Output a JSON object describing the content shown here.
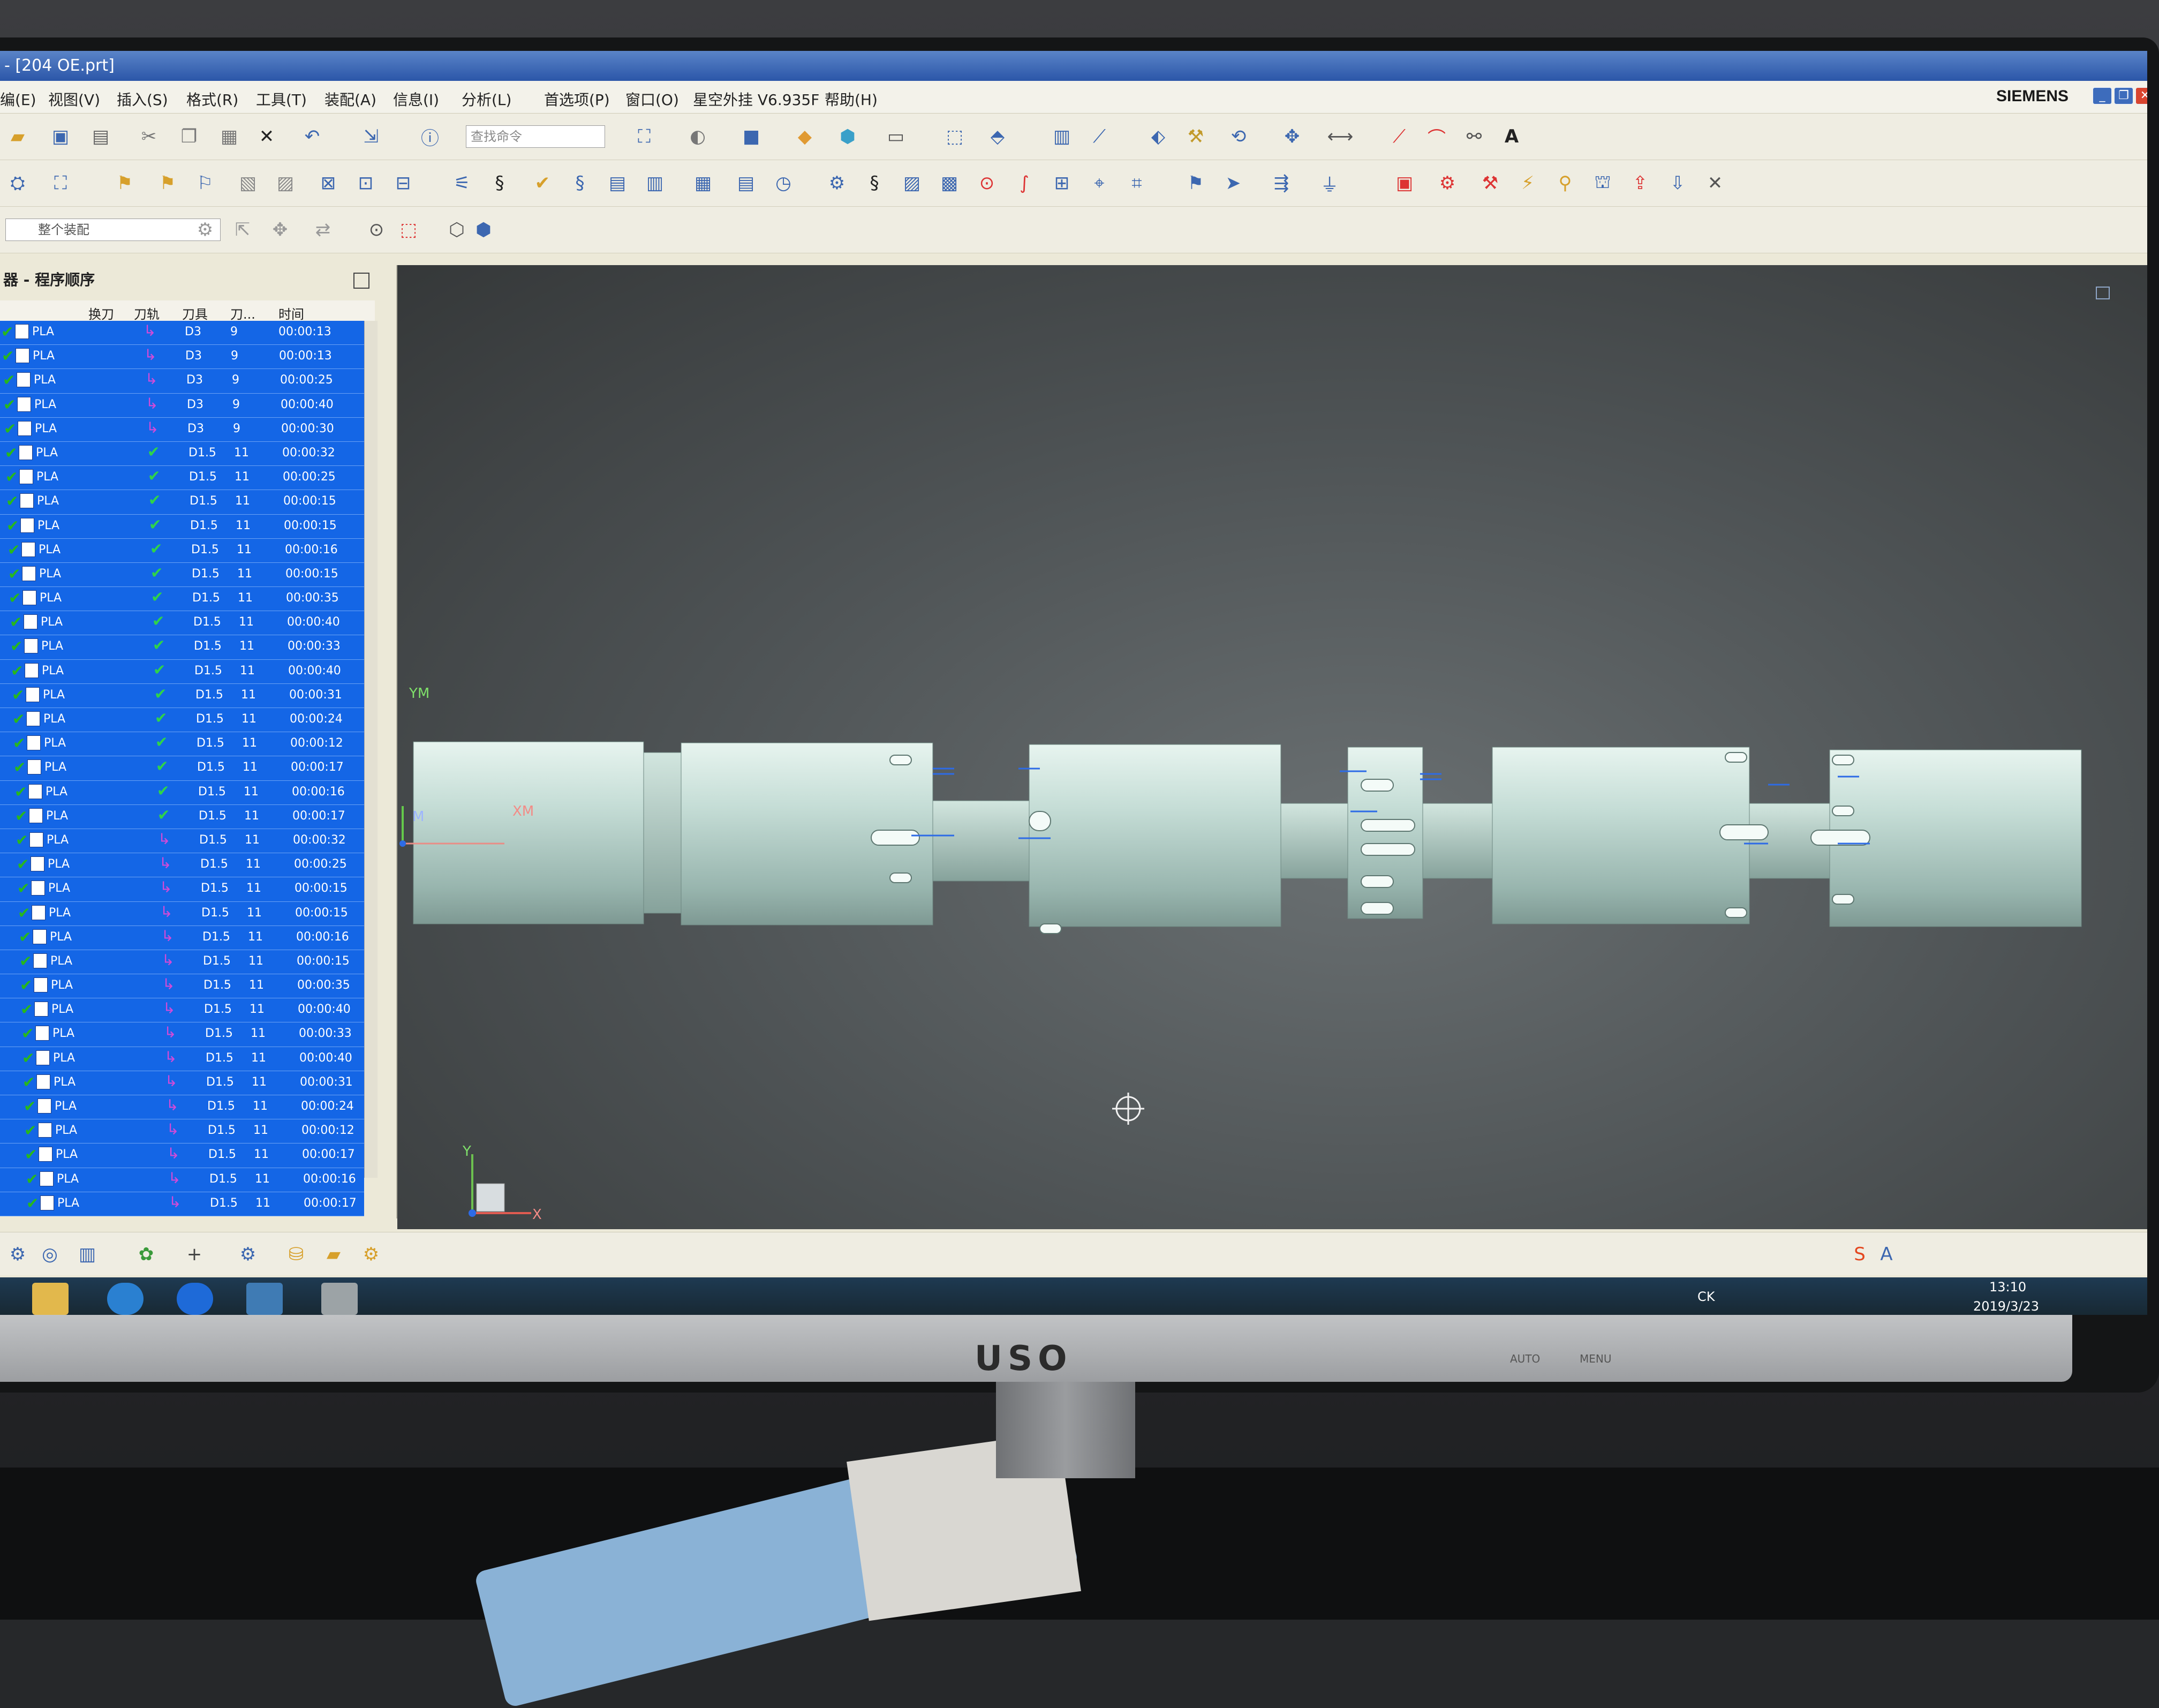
{
  "window": {
    "title": "- [204 OE.prt]",
    "brand": "SIEMENS"
  },
  "menu": [
    "编(E)",
    "视图(V)",
    "插入(S)",
    "格式(R)",
    "工具(T)",
    "装配(A)",
    "信息(I)",
    "分析(L)",
    "首选项(P)",
    "窗口(O)",
    "星空外挂 V6.935F",
    "帮助(H)"
  ],
  "toolbar": {
    "search_placeholder": "查找命令",
    "assembly_filter": "整个装配"
  },
  "navigator": {
    "title": "器 - 程序顺序",
    "columns": [
      "换刀",
      "刀轨",
      "刀具",
      "刀...",
      "时间"
    ],
    "rows": [
      {
        "name": "PLA",
        "path": "arrow",
        "tool": "D3",
        "num": "9",
        "time": "00:00:13"
      },
      {
        "name": "PLA",
        "path": "arrow",
        "tool": "D3",
        "num": "9",
        "time": "00:00:13"
      },
      {
        "name": "PLA",
        "path": "arrow",
        "tool": "D3",
        "num": "9",
        "time": "00:00:25"
      },
      {
        "name": "PLA",
        "path": "arrow",
        "tool": "D3",
        "num": "9",
        "time": "00:00:40"
      },
      {
        "name": "PLA",
        "path": "arrow",
        "tool": "D3",
        "num": "9",
        "time": "00:00:30"
      },
      {
        "name": "PLA",
        "path": "ok",
        "tool": "D1.5",
        "num": "11",
        "time": "00:00:32"
      },
      {
        "name": "PLA",
        "path": "ok",
        "tool": "D1.5",
        "num": "11",
        "time": "00:00:25"
      },
      {
        "name": "PLA",
        "path": "ok",
        "tool": "D1.5",
        "num": "11",
        "time": "00:00:15"
      },
      {
        "name": "PLA",
        "path": "ok",
        "tool": "D1.5",
        "num": "11",
        "time": "00:00:15"
      },
      {
        "name": "PLA",
        "path": "ok",
        "tool": "D1.5",
        "num": "11",
        "time": "00:00:16"
      },
      {
        "name": "PLA",
        "path": "ok",
        "tool": "D1.5",
        "num": "11",
        "time": "00:00:15"
      },
      {
        "name": "PLA",
        "path": "ok",
        "tool": "D1.5",
        "num": "11",
        "time": "00:00:35"
      },
      {
        "name": "PLA",
        "path": "ok",
        "tool": "D1.5",
        "num": "11",
        "time": "00:00:40"
      },
      {
        "name": "PLA",
        "path": "ok",
        "tool": "D1.5",
        "num": "11",
        "time": "00:00:33"
      },
      {
        "name": "PLA",
        "path": "ok",
        "tool": "D1.5",
        "num": "11",
        "time": "00:00:40"
      },
      {
        "name": "PLA",
        "path": "ok",
        "tool": "D1.5",
        "num": "11",
        "time": "00:00:31"
      },
      {
        "name": "PLA",
        "path": "ok",
        "tool": "D1.5",
        "num": "11",
        "time": "00:00:24"
      },
      {
        "name": "PLA",
        "path": "ok",
        "tool": "D1.5",
        "num": "11",
        "time": "00:00:12"
      },
      {
        "name": "PLA",
        "path": "ok",
        "tool": "D1.5",
        "num": "11",
        "time": "00:00:17"
      },
      {
        "name": "PLA",
        "path": "ok",
        "tool": "D1.5",
        "num": "11",
        "time": "00:00:16"
      },
      {
        "name": "PLA",
        "path": "ok",
        "tool": "D1.5",
        "num": "11",
        "time": "00:00:17"
      },
      {
        "name": "PLA",
        "path": "arrow",
        "tool": "D1.5",
        "num": "11",
        "time": "00:00:32"
      },
      {
        "name": "PLA",
        "path": "arrow",
        "tool": "D1.5",
        "num": "11",
        "time": "00:00:25"
      },
      {
        "name": "PLA",
        "path": "arrow",
        "tool": "D1.5",
        "num": "11",
        "time": "00:00:15"
      },
      {
        "name": "PLA",
        "path": "arrow",
        "tool": "D1.5",
        "num": "11",
        "time": "00:00:15"
      },
      {
        "name": "PLA",
        "path": "arrow",
        "tool": "D1.5",
        "num": "11",
        "time": "00:00:16"
      },
      {
        "name": "PLA",
        "path": "arrow",
        "tool": "D1.5",
        "num": "11",
        "time": "00:00:15"
      },
      {
        "name": "PLA",
        "path": "arrow",
        "tool": "D1.5",
        "num": "11",
        "time": "00:00:35"
      },
      {
        "name": "PLA",
        "path": "arrow",
        "tool": "D1.5",
        "num": "11",
        "time": "00:00:40"
      },
      {
        "name": "PLA",
        "path": "arrow",
        "tool": "D1.5",
        "num": "11",
        "time": "00:00:33"
      },
      {
        "name": "PLA",
        "path": "arrow",
        "tool": "D1.5",
        "num": "11",
        "time": "00:00:40"
      },
      {
        "name": "PLA",
        "path": "arrow",
        "tool": "D1.5",
        "num": "11",
        "time": "00:00:31"
      },
      {
        "name": "PLA",
        "path": "arrow",
        "tool": "D1.5",
        "num": "11",
        "time": "00:00:24"
      },
      {
        "name": "PLA",
        "path": "arrow",
        "tool": "D1.5",
        "num": "11",
        "time": "00:00:12"
      },
      {
        "name": "PLA",
        "path": "arrow",
        "tool": "D1.5",
        "num": "11",
        "time": "00:00:17"
      },
      {
        "name": "PLA",
        "path": "arrow",
        "tool": "D1.5",
        "num": "11",
        "time": "00:00:16"
      },
      {
        "name": "PLA",
        "path": "arrow",
        "tool": "D1.5",
        "num": "11",
        "time": "00:00:17"
      }
    ]
  },
  "viewport": {
    "axis": {
      "ym": "YM",
      "xm": "XM",
      "m": "M",
      "y": "Y",
      "x": "X"
    }
  },
  "taskbar": {
    "time": "13:10",
    "date": "2019/3/23",
    "lang": "CK"
  },
  "monitor": {
    "logo": "USO",
    "auto": "AUTO",
    "menu": "MENU"
  }
}
